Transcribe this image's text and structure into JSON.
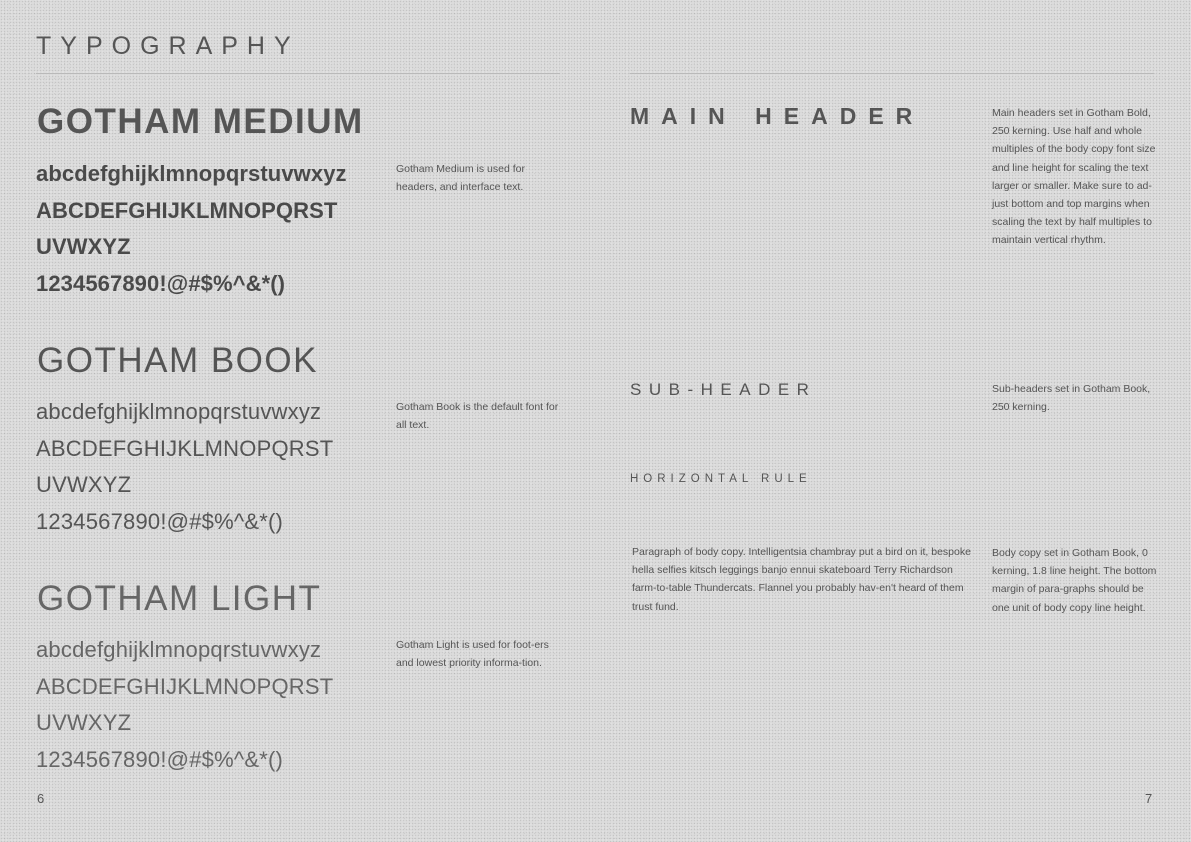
{
  "title": "TYPOGRAPHY",
  "fonts": {
    "medium": {
      "name": "GOTHAM MEDIUM",
      "lines": [
        "abcdefghijklmnopqrstuvwxyz",
        "ABCDEFGHIJKLMNOPQRST",
        "UVWXYZ",
        "1234567890!@#$%^&*()"
      ],
      "note": "Gotham Medium is used for headers, and interface text."
    },
    "book": {
      "name": "GOTHAM BOOK",
      "lines": [
        "abcdefghijklmnopqrstuvwxyz",
        "ABCDEFGHIJKLMNOPQRST",
        "UVWXYZ",
        "1234567890!@#$%^&*()"
      ],
      "note": "Gotham Book is the default font for all text."
    },
    "light": {
      "name": "GOTHAM LIGHT",
      "lines": [
        "abcdefghijklmnopqrstuvwxyz",
        "ABCDEFGHIJKLMNOPQRST",
        "UVWXYZ",
        "1234567890!@#$%^&*()"
      ],
      "note": "Gotham Light is used for foot-ers and lowest priority informa-tion."
    }
  },
  "main_header": {
    "label": "MAIN HEADER",
    "note": "Main headers set in Gotham Bold, 250 kerning. Use half and whole multiples of the body copy font size and line height for scaling the text larger or smaller. Make sure to ad-just bottom and top margins when scaling the text by half multiples to maintain vertical rhythm."
  },
  "sub_header": {
    "label": "SUB-HEADER",
    "note": "Sub-headers set in Gotham Book, 250 kerning."
  },
  "horizontal_rule": {
    "label": "HORIZONTAL RULE"
  },
  "body_copy": {
    "paragraph": "Paragraph of body copy. Intelligentsia chambray put a bird on it, bespoke hella selfies kitsch leggings banjo ennui skateboard Terry Richardson farm-to-table Thundercats. Flannel you probably hav-en't heard of them trust fund.",
    "note": "Body copy set in Gotham Book, 0 kerning, 1.8 line height. The bottom margin of para-graphs should be one unit of body copy line height."
  },
  "page_numbers": {
    "left": "6",
    "right": "7"
  }
}
